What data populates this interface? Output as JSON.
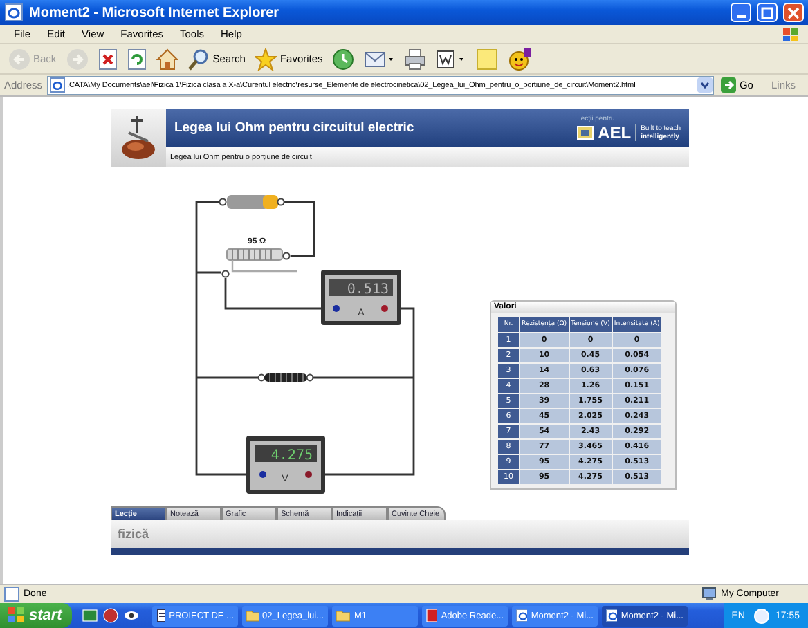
{
  "window": {
    "title": "Moment2 - Microsoft Internet Explorer"
  },
  "menu": [
    "File",
    "Edit",
    "View",
    "Favorites",
    "Tools",
    "Help"
  ],
  "toolbar": [
    {
      "kind": "back",
      "label": "Back",
      "disabled": true
    },
    {
      "kind": "forward",
      "disabled": true
    },
    {
      "kind": "stop",
      "disabled": false
    },
    {
      "kind": "refresh",
      "disabled": false
    },
    {
      "kind": "home",
      "disabled": false
    },
    {
      "kind": "search",
      "label": "Search",
      "disabled": false
    },
    {
      "kind": "favorites",
      "label": "Favorites",
      "disabled": false
    },
    {
      "kind": "history",
      "disabled": false
    },
    {
      "kind": "mail",
      "disabled": false
    },
    {
      "kind": "print",
      "disabled": false
    },
    {
      "kind": "word",
      "disabled": false
    },
    {
      "kind": "note",
      "disabled": false
    },
    {
      "kind": "messenger",
      "disabled": false
    }
  ],
  "address": {
    "label": "Address",
    "value": ".CATA\\My Documents\\ael\\Fizica 1\\Fizica clasa a X-a\\Curentul electric\\resurse_Elemente de electrocinetica\\02_Legea_lui_Ohm_pentru_o_portiune_de_circuit\\Moment2.html",
    "go": "Go",
    "links": "Links"
  },
  "lesson": {
    "title": "Legea lui Ohm pentru circuitul electric",
    "subtitle": "Legea lui Ohm pentru o porțiune de circuit",
    "brand": {
      "caption": "Lecții pentru",
      "name": "AEL",
      "tagline": "Built to teach",
      "tagline_bold": "intelligently"
    }
  },
  "circuit": {
    "resistor_label": "95 Ω",
    "ammeter": {
      "reading": "0.513",
      "unit": "A"
    },
    "voltmeter": {
      "reading": "4.275",
      "unit": "V"
    }
  },
  "table": {
    "title": "Valori",
    "columns": [
      "Nr.",
      "Rezistența (Ω)",
      "Tensiune (V)",
      "Intensitate (A)"
    ],
    "rows": [
      [
        "1",
        "0",
        "0",
        "0"
      ],
      [
        "2",
        "10",
        "0.45",
        "0.054"
      ],
      [
        "3",
        "14",
        "0.63",
        "0.076"
      ],
      [
        "4",
        "28",
        "1.26",
        "0.151"
      ],
      [
        "5",
        "39",
        "1.755",
        "0.211"
      ],
      [
        "6",
        "45",
        "2.025",
        "0.243"
      ],
      [
        "7",
        "54",
        "2.43",
        "0.292"
      ],
      [
        "8",
        "77",
        "3.465",
        "0.416"
      ],
      [
        "9",
        "95",
        "4.275",
        "0.513"
      ],
      [
        "10",
        "95",
        "4.275",
        "0.513"
      ]
    ]
  },
  "tabs": [
    {
      "label": "Lecție",
      "selected": true
    },
    {
      "label": "Notează",
      "selected": false
    },
    {
      "label": "Grafic",
      "selected": false
    },
    {
      "label": "Schemă",
      "selected": false
    },
    {
      "label": "Indicații",
      "selected": false
    },
    {
      "label": "Cuvinte Cheie",
      "selected": false
    }
  ],
  "footer": {
    "label": "fizică"
  },
  "status_bar": {
    "text": "Done",
    "zone": "My Computer"
  },
  "taskbar": {
    "start": "start",
    "tasks": [
      {
        "kind": "doc",
        "label": "PROIECT DE ...",
        "selected": false
      },
      {
        "kind": "folder",
        "label": "02_Legea_lui...",
        "selected": false
      },
      {
        "kind": "folder",
        "label": "M1",
        "selected": false
      },
      {
        "kind": "pdf",
        "label": "Adobe Reade...",
        "selected": false
      },
      {
        "kind": "ie",
        "label": "Moment2 - Mi...",
        "selected": false
      },
      {
        "kind": "ie",
        "label": "Moment2 - Mi...",
        "selected": true
      }
    ],
    "language": "EN",
    "clock": "17:55"
  }
}
